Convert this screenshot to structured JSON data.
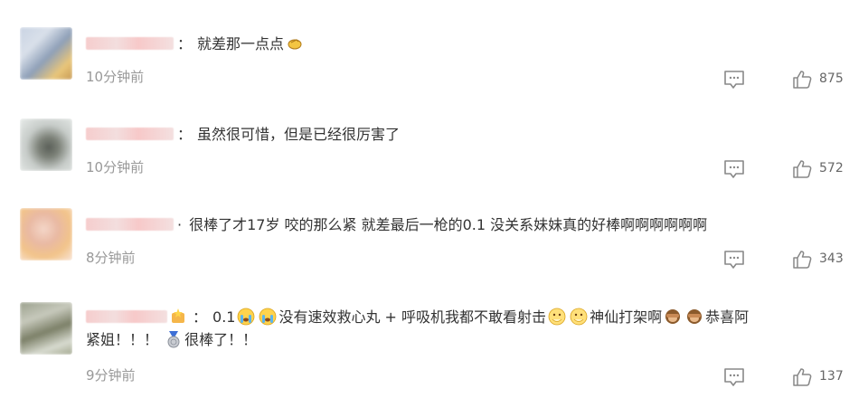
{
  "comments": [
    {
      "segments": [
        "就差那一点点"
      ],
      "time": "10分钟前",
      "likes": "875"
    },
    {
      "segments": [
        "虽然很可惜，但是已经很厉害了"
      ],
      "time": "10分钟前",
      "likes": "572"
    },
    {
      "segments": [
        "很棒了才17岁 咬的那么紧 就差最后一枪的0.1 没关系妹妹真的好棒啊啊啊啊啊啊"
      ],
      "time": "8分钟前",
      "likes": "343"
    },
    {
      "segments": [
        "0.1",
        "没有速效救心丸 + 呼吸机我都不敢看射击",
        "神仙打架啊",
        "恭喜阿",
        "紧姐！！！",
        "很棒了！！"
      ],
      "time": "9分钟前",
      "likes": "137"
    }
  ],
  "separator": "：",
  "icons": {
    "reply": "comment-bubble-icon",
    "like": "thumbs-up-icon",
    "emojis": [
      "pinching-hand-emoji",
      "crying-emoji",
      "crying-emoji",
      "face-with-hand-emoji",
      "face-with-hand-emoji",
      "see-no-evil-monkey-emoji",
      "see-no-evil-monkey-emoji",
      "medal-emoji",
      "sparkle-badge-emoji"
    ]
  },
  "colors": {
    "text": "#333333",
    "meta": "#999999",
    "icon": "#888888"
  }
}
